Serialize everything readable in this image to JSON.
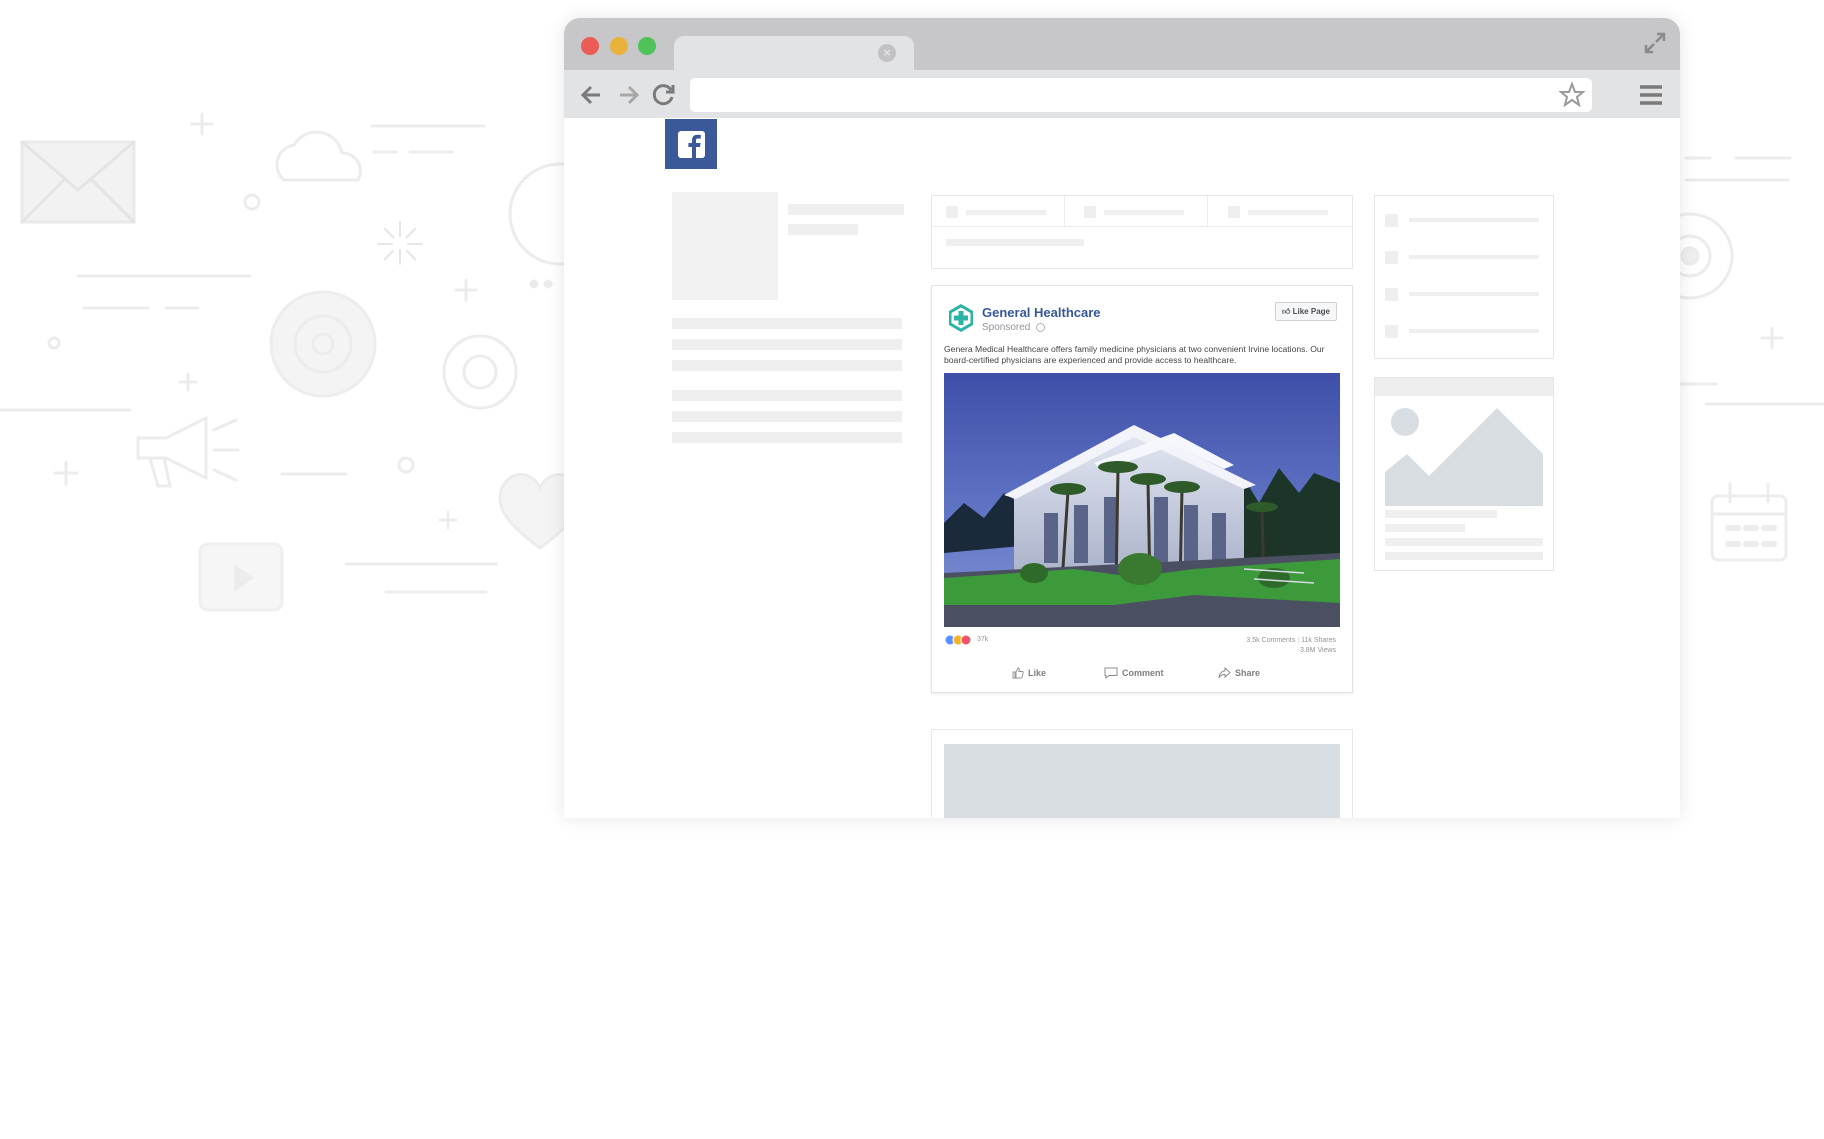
{
  "browser": {
    "window_controls": {
      "close_color": "#ec5b55",
      "minimize_color": "#e8b33a",
      "maximize_color": "#4fc35a"
    },
    "tab": {
      "title": ""
    },
    "url": {
      "value": ""
    },
    "icons": [
      "back-icon",
      "forward-icon",
      "reload-icon",
      "bookmark-star-icon",
      "menu-icon",
      "fullscreen-icon",
      "tab-close-icon"
    ]
  },
  "site": {
    "brand": "facebook",
    "brand_color": "#3b5998"
  },
  "post": {
    "page_name": "General Healthcare",
    "sponsored": "Sponsored",
    "like_page_label": "Like Page",
    "text": "Genera Medical Healthcare offers family medicine physicians at two convenient Irvine locations. Our board-certified physicians are experienced and provide access to healthcare.",
    "image_alt": "Modern medical clinic building at dusk with palm trees",
    "reactions_count": "37k",
    "comments": "3.5k Comments",
    "shares": "11k Shares",
    "views": "3.8M Views",
    "actions": {
      "like": "Like",
      "comment": "Comment",
      "share": "Share"
    },
    "avatar_color": "#2bb4a6"
  }
}
